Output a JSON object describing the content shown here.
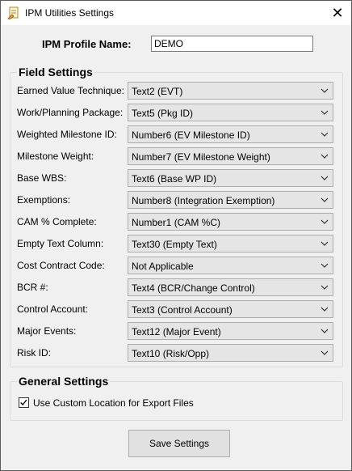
{
  "window": {
    "title": "IPM Utilities Settings",
    "close_glyph": "✕"
  },
  "profile": {
    "label": "IPM Profile Name:",
    "value": "DEMO"
  },
  "field_settings": {
    "title": "Field Settings",
    "rows": [
      {
        "label": "Earned Value Technique:",
        "value": "Text2 (EVT)"
      },
      {
        "label": "Work/Planning Package:",
        "value": "Text5 (Pkg ID)"
      },
      {
        "label": "Weighted Milestone ID:",
        "value": "Number6 (EV Milestone ID)"
      },
      {
        "label": "Milestone Weight:",
        "value": "Number7 (EV Milestone Weight)"
      },
      {
        "label": "Base WBS:",
        "value": "Text6 (Base WP ID)"
      },
      {
        "label": "Exemptions:",
        "value": "Number8 (Integration Exemption)"
      },
      {
        "label": "CAM % Complete:",
        "value": "Number1 (CAM %C)"
      },
      {
        "label": "Empty Text Column:",
        "value": "Text30 (Empty Text)"
      },
      {
        "label": "Cost Contract Code:",
        "value": "Not Applicable"
      },
      {
        "label": "BCR #:",
        "value": "Text4 (BCR/Change Control)"
      },
      {
        "label": "Control Account:",
        "value": "Text3 (Control Account)"
      },
      {
        "label": "Major Events:",
        "value": "Text12 (Major Event)"
      },
      {
        "label": "Risk ID:",
        "value": "Text10 (Risk/Opp)"
      }
    ]
  },
  "general_settings": {
    "title": "General Settings",
    "custom_location_label": "Use Custom Location for Export Files",
    "custom_location_checked": true
  },
  "save_label": "Save Settings"
}
